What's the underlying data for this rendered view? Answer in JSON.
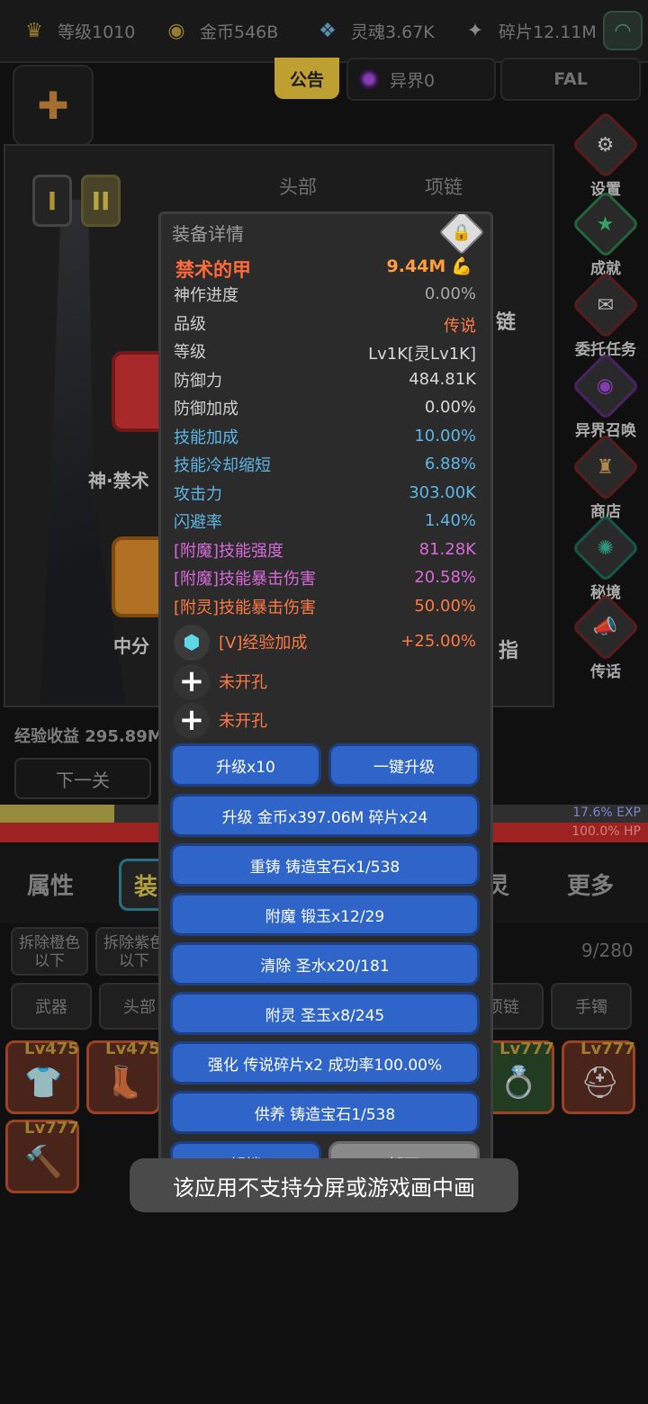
{
  "topbar": {
    "level": "等级1010",
    "gold": "金币546B",
    "soul": "灵魂3.67K",
    "shards": "碎片12.11M"
  },
  "row2": {
    "notice": "公告",
    "otherworld": "异界0",
    "fal": "FAL"
  },
  "equip_panel": {
    "tab_1": "I",
    "tab_2": "II",
    "slot_head": "头部",
    "slot_necklace": "项链",
    "weapon_name": "神·禁术",
    "zhongfen": "中分",
    "lian": "链",
    "zhi": "指"
  },
  "side_menu": [
    "设置",
    "成就",
    "委托任务",
    "异界召唤",
    "商店",
    "秘境",
    "传话"
  ],
  "exp_info": "经验收益 295.89M",
  "next_button": "下一关",
  "bars": {
    "exp_text": "17.6% EXP",
    "exp_fraction": 0.176,
    "hp_text": "100.0%  HP"
  },
  "bottom_tabs": {
    "attr": "属性",
    "equip": "装",
    "spirit": "灵",
    "more": "更多"
  },
  "filters": {
    "remove_orange": "拆除橙色以下",
    "remove_purple": "拆除紫色以下",
    "count": "9/280"
  },
  "categories": [
    "武器",
    "头部",
    "项链",
    "手镯"
  ],
  "items": [
    {
      "lv": "Lv475",
      "icon": "shirt-icon"
    },
    {
      "lv": "Lv475",
      "icon": "boot-icon"
    },
    {
      "lv": "Lv777",
      "icon": "ring-icon"
    },
    {
      "lv": "Lv777",
      "icon": "helmet-icon"
    },
    {
      "lv": "Lv777",
      "icon": "hammer-icon"
    }
  ],
  "modal": {
    "title": "装备详情",
    "name": "禁术的甲",
    "power": "9.44M",
    "stats": [
      {
        "k": "神作进度",
        "v": "0.00%",
        "kc": "#cfcfcf",
        "vc": "#a8a8a8"
      },
      {
        "k": "品级",
        "v": "传说",
        "kc": "#cfcfcf",
        "vc": "#ff7a45"
      },
      {
        "k": "等级",
        "v": "Lv1K[灵Lv1K]",
        "kc": "#cfcfcf",
        "vc": "#d8d8d8"
      },
      {
        "k": "防御力",
        "v": "484.81K",
        "kc": "#cfcfcf",
        "vc": "#d8d8d8"
      },
      {
        "k": "防御加成",
        "v": "0.00%",
        "kc": "#cfcfcf",
        "vc": "#d8d8d8"
      },
      {
        "k": "技能加成",
        "v": "10.00%",
        "kc": "#5eb6e6",
        "vc": "#5eb6e6"
      },
      {
        "k": "技能冷却缩短",
        "v": "6.88%",
        "kc": "#5eb6e6",
        "vc": "#5eb6e6"
      },
      {
        "k": "攻击力",
        "v": "303.00K",
        "kc": "#5eb6e6",
        "vc": "#5eb6e6"
      },
      {
        "k": "闪避率",
        "v": "1.40%",
        "kc": "#5eb6e6",
        "vc": "#5eb6e6"
      },
      {
        "k": "[附魔]技能强度",
        "v": "81.28K",
        "kc": "#d86ad8",
        "vc": "#d86ad8"
      },
      {
        "k": "[附魔]技能暴击伤害",
        "v": "20.58%",
        "kc": "#d86ad8",
        "vc": "#d86ad8"
      },
      {
        "k": "[附灵]技能暴击伤害",
        "v": "50.00%",
        "kc": "#ff7a45",
        "vc": "#ff7a45"
      }
    ],
    "gem": {
      "k": "[V]经验加成",
      "v": "+25.00%"
    },
    "sockets": [
      "未开孔",
      "未开孔"
    ],
    "actions": {
      "up10": "升级x10",
      "oneclick": "一键升级",
      "upgrade": "升级 金币x397.06M 碎片x24",
      "recast": "重铸 铸造宝石x1/538",
      "enchant": "附魔 锻玉x12/29",
      "clear": "清除 圣水x20/181",
      "spirit": "附灵 圣玉x8/245",
      "strengthen": "强化 传说碎片x2 成功率100.00%",
      "nurture": "供养 铸造宝石1/538",
      "unlock": "解锁",
      "unequip": "卸下"
    }
  },
  "toast": "该应用不支持分屏或游戏画中画"
}
